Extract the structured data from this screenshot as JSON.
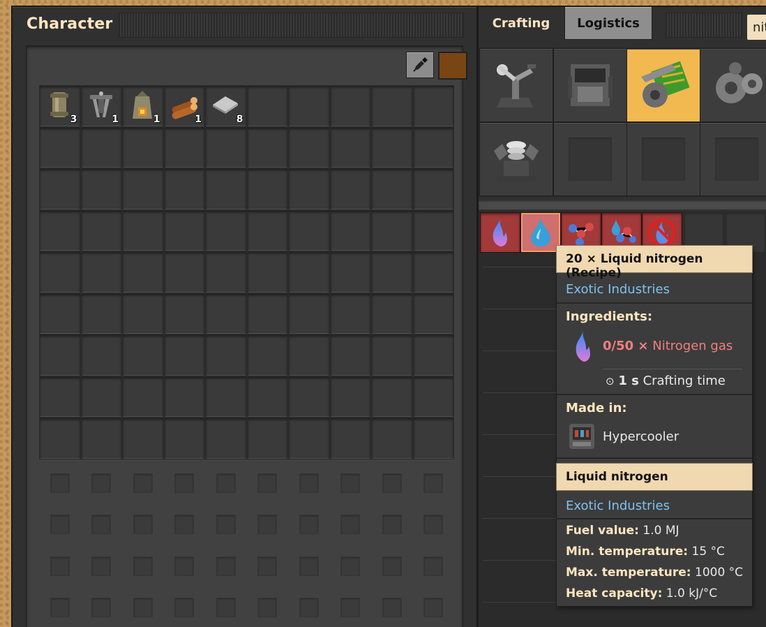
{
  "character": {
    "title": "Character",
    "inventory": [
      {
        "icon": "pipe-icon",
        "count": "3"
      },
      {
        "icon": "burner-mining-drill-icon",
        "count": "1"
      },
      {
        "icon": "stone-furnace-icon",
        "count": "1"
      },
      {
        "icon": "wood-icon",
        "count": "1"
      },
      {
        "icon": "iron-plate-icon",
        "count": "8"
      }
    ]
  },
  "crafting": {
    "tabs": [
      "Crafting",
      "Logistics"
    ],
    "search_text": "nitrogen"
  },
  "tooltip": {
    "recipe_title": "20 × Liquid nitrogen (Recipe)",
    "recipe_mod": "Exotic Industries",
    "ingredients_label": "Ingredients:",
    "ingredient_amount": "0/50 ×",
    "ingredient_name": "Nitrogen gas",
    "crafting_time_value": "1 s",
    "crafting_time_label": "Crafting time",
    "made_in_label": "Made in:",
    "machine": "Hypercooler",
    "item_title": "Liquid nitrogen",
    "item_mod": "Exotic Industries",
    "fuel_value_label": "Fuel value:",
    "fuel_value": "1.0 MJ",
    "min_temp_label": "Min. temperature:",
    "min_temp": "15 °C",
    "max_temp_label": "Max. temperature:",
    "max_temp": "1000 °C",
    "heat_capacity_label": "Heat capacity:",
    "heat_capacity": "1.0 kJ/°C"
  },
  "colors": {
    "selected_group": "#f2b950",
    "recipe_unavailable": "#a23a3a",
    "mod_name": "#7ec2f0",
    "header": "#ffe6c0"
  }
}
